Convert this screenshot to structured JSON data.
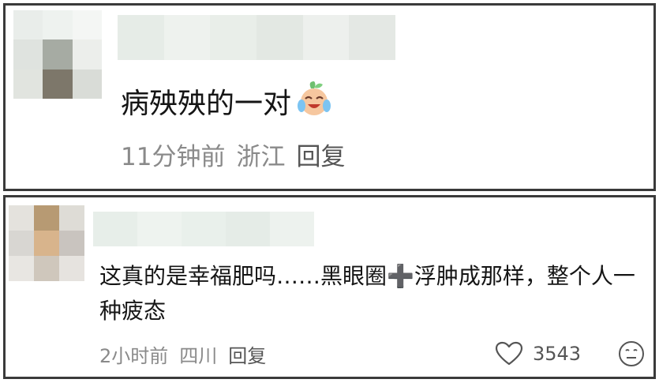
{
  "comments": [
    {
      "text": "病殃殃的一对",
      "emoji": "crying-laughing-emoji",
      "time": "11分钟前",
      "location": "浙江",
      "reply": "回复"
    },
    {
      "text": "这真的是幸福肥吗……黑眼圈➕浮肿成那样，整个人一种疲态",
      "time": "2小时前",
      "location": "四川",
      "reply": "回复",
      "likes": "3543"
    }
  ],
  "colors": {
    "border": "#3a3a3a",
    "meta_text": "#8a8a8a",
    "main_text": "#151515"
  }
}
